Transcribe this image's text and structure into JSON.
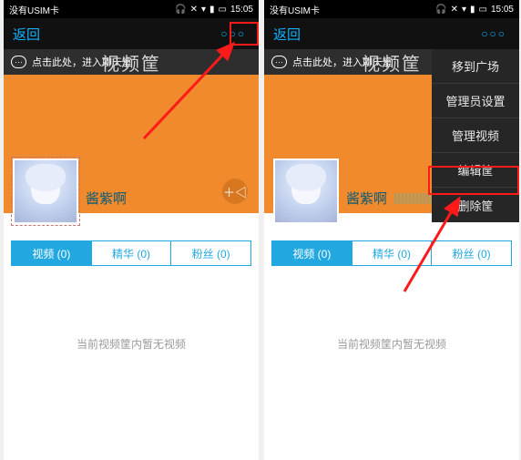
{
  "status": {
    "sim": "没有USIM卡",
    "time": "15:05"
  },
  "nav": {
    "back": "返回",
    "more_glyph": "○○○"
  },
  "chat": {
    "icon": "···",
    "text": "点击此处，进入聊天室",
    "bg_title": "视频筐"
  },
  "profile": {
    "username": "酱紫啊"
  },
  "video_badge": "＋◁",
  "tabs": [
    {
      "label": "视频  (0)",
      "active": true
    },
    {
      "label": "精华  (0)",
      "active": false
    },
    {
      "label": "粉丝  (0)",
      "active": false
    }
  ],
  "empty": "当前视频筐内暂无视频",
  "dropdown": {
    "items": [
      "移到广场",
      "管理员设置",
      "管理视频",
      "编辑筐",
      "删除筐"
    ],
    "highlight_index": 3
  }
}
